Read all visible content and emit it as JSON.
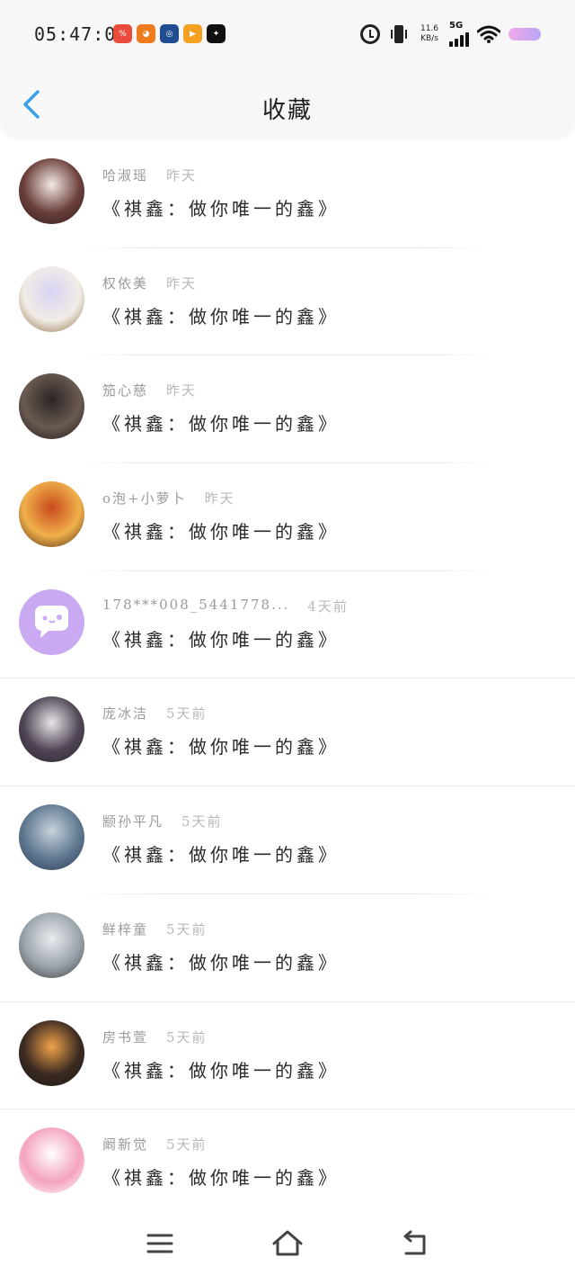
{
  "status_bar": {
    "time": "05:47:06",
    "net_speed_value": "11.6",
    "net_speed_unit": "KB/s",
    "network_type": "5G",
    "app_icons": [
      {
        "name": "sale-app-icon",
        "color": "#e94b3c",
        "text": "%"
      },
      {
        "name": "pumpkin-app-icon",
        "color": "#f07b1c",
        "text": "◕"
      },
      {
        "name": "blue-app-icon",
        "color": "#1f4d8f",
        "text": "◎"
      },
      {
        "name": "video-app-icon",
        "color": "#f4a021",
        "text": "▶"
      },
      {
        "name": "sparkle-app-icon",
        "color": "#111111",
        "text": "✦"
      }
    ]
  },
  "header": {
    "title": "收藏",
    "accent_color": "#3aa0e8"
  },
  "items": [
    {
      "name": "哈淑瑶",
      "time": "昨天",
      "title": "《祺鑫：做你唯一的鑫》",
      "avatar": [
        "#f3e9e6",
        "#6b3f3a",
        "#2a1c1c"
      ]
    },
    {
      "name": "权依美",
      "time": "昨天",
      "title": "《祺鑫：做你唯一的鑫》",
      "avatar": [
        "#d9d3f4",
        "#f1ece6",
        "#8c6a3f"
      ]
    },
    {
      "name": "笳心慈",
      "time": "昨天",
      "title": "《祺鑫：做你唯一的鑫》",
      "avatar": [
        "#2b2623",
        "#6a5a52",
        "#1b1715"
      ]
    },
    {
      "name": "o泡+小萝卜",
      "time": "昨天",
      "title": "《祺鑫：做你唯一的鑫》",
      "avatar": [
        "#c94a1f",
        "#f0b04a",
        "#4a2a18"
      ]
    },
    {
      "name": "178***008_5441778...",
      "time": "4天前",
      "title": "《祺鑫：做你唯一的鑫》",
      "avatar": [
        "#c9a9f2",
        "#c9a9f2",
        "#ffffff"
      ]
    },
    {
      "name": "庞冰洁",
      "time": "5天前",
      "title": "《祺鑫：做你唯一的鑫》",
      "avatar": [
        "#e8e4e8",
        "#4f4555",
        "#2a232b"
      ]
    },
    {
      "name": "颛孙平凡",
      "time": "5天前",
      "title": "《祺鑫：做你唯一的鑫》",
      "avatar": [
        "#c8d3dc",
        "#5f7890",
        "#2a3b52"
      ]
    },
    {
      "name": "鲜梓童",
      "time": "5天前",
      "title": "《祺鑫：做你唯一的鑫》",
      "avatar": [
        "#e9ecef",
        "#9aa3ab",
        "#3b3a3c"
      ]
    },
    {
      "name": "房书萱",
      "time": "5天前",
      "title": "《祺鑫：做你唯一的鑫》",
      "avatar": [
        "#f0a34a",
        "#3b2a22",
        "#1c1614"
      ]
    },
    {
      "name": "阚新觉",
      "time": "5天前",
      "title": "《祺鑫：做你唯一的鑫》",
      "avatar": [
        "#ffffff",
        "#f4a3c0",
        "#ffffff"
      ]
    }
  ],
  "full_width_dividers_after": [
    4,
    5,
    7,
    8
  ],
  "nav_bar": {
    "menu_icon": "menu-icon",
    "home_icon": "home-icon",
    "back_icon": "back-arrow-icon"
  }
}
